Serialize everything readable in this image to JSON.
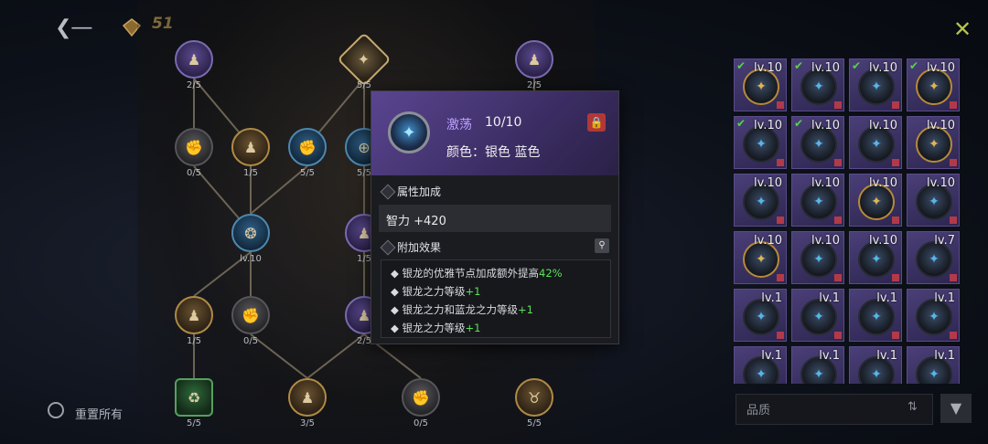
{
  "header": {
    "back_icon": "back-arrow-icon",
    "currency_value": "51",
    "close_icon": "close-icon"
  },
  "tree": {
    "nodes": [
      {
        "id": "n1",
        "label": "2/5",
        "style": "purple",
        "glyph": "♟"
      },
      {
        "id": "n2",
        "label": "5/5",
        "style": "diamond",
        "glyph": "✦"
      },
      {
        "id": "n3",
        "label": "2/5",
        "style": "purple",
        "glyph": "♟"
      },
      {
        "id": "n4",
        "label": "0/5",
        "style": "grey",
        "glyph": "✊"
      },
      {
        "id": "n5",
        "label": "1/5",
        "style": "gold",
        "glyph": "♟"
      },
      {
        "id": "n6",
        "label": "5/5",
        "style": "blue",
        "glyph": "✊"
      },
      {
        "id": "n7",
        "label": "5/5",
        "style": "blue",
        "glyph": "⊕"
      },
      {
        "id": "n8",
        "label": "lv.10",
        "style": "blue",
        "glyph": "❂"
      },
      {
        "id": "n9",
        "label": "1/5",
        "style": "purple",
        "glyph": "♟"
      },
      {
        "id": "n10",
        "label": "1/5",
        "style": "gold",
        "glyph": "♟"
      },
      {
        "id": "n11",
        "label": "0/5",
        "style": "grey",
        "glyph": "✊"
      },
      {
        "id": "n12",
        "label": "2/5",
        "style": "purple",
        "glyph": "♟"
      },
      {
        "id": "n13",
        "label": "5/5",
        "style": "green",
        "glyph": "♻"
      },
      {
        "id": "n14",
        "label": "3/5",
        "style": "gold",
        "glyph": "♟"
      },
      {
        "id": "n15",
        "label": "0/5",
        "style": "grey",
        "glyph": "✊"
      },
      {
        "id": "n16",
        "label": "5/5",
        "style": "gold",
        "glyph": "♉"
      }
    ],
    "reset_label": "重置所有"
  },
  "tooltip": {
    "name": "激荡",
    "level": "10/10",
    "color_line": "颜色：银色 蓝色",
    "lock_icon": "lock-icon",
    "attr_title": "属性加成",
    "attr_value": "智力 +420",
    "extra_title": "附加效果",
    "search_icon": "magnify-icon",
    "effects": [
      {
        "text": "银龙的优雅节点加成额外提高",
        "value": "42%"
      },
      {
        "text": "银龙之力等级",
        "value": "+1"
      },
      {
        "text": "银龙之力和蓝龙之力等级",
        "value": "+1"
      },
      {
        "text": "银龙之力等级",
        "value": "+1"
      }
    ]
  },
  "inventory": {
    "slots": [
      {
        "level": "lv.10",
        "checked": true,
        "gold": true
      },
      {
        "level": "lv.10",
        "checked": true,
        "gold": false
      },
      {
        "level": "lv.10",
        "checked": true,
        "gold": false
      },
      {
        "level": "lv.10",
        "checked": true,
        "gold": true
      },
      {
        "level": "lv.10",
        "checked": true,
        "gold": false
      },
      {
        "level": "lv.10",
        "checked": true,
        "gold": false
      },
      {
        "level": "lv.10",
        "checked": false,
        "gold": false
      },
      {
        "level": "lv.10",
        "checked": false,
        "gold": true
      },
      {
        "level": "lv.10",
        "checked": false,
        "gold": false
      },
      {
        "level": "lv.10",
        "checked": false,
        "gold": false
      },
      {
        "level": "lv.10",
        "checked": false,
        "gold": true
      },
      {
        "level": "lv.10",
        "checked": false,
        "gold": false
      },
      {
        "level": "lv.10",
        "checked": false,
        "gold": true
      },
      {
        "level": "lv.10",
        "checked": false,
        "gold": false
      },
      {
        "level": "lv.10",
        "checked": false,
        "gold": false
      },
      {
        "level": "lv.7",
        "checked": false,
        "gold": false
      },
      {
        "level": "lv.1",
        "checked": false,
        "gold": false
      },
      {
        "level": "lv.1",
        "checked": false,
        "gold": false
      },
      {
        "level": "lv.1",
        "checked": false,
        "gold": false
      },
      {
        "level": "lv.1",
        "checked": false,
        "gold": false
      },
      {
        "level": "lv.1",
        "checked": false,
        "gold": false
      },
      {
        "level": "lv.1",
        "checked": false,
        "gold": false
      },
      {
        "level": "lv.1",
        "checked": false,
        "gold": false
      },
      {
        "level": "lv.1",
        "checked": false,
        "gold": false
      }
    ],
    "filter_label": "品质",
    "sort_icon": "sort-icon",
    "filter_icon": "funnel-icon"
  }
}
